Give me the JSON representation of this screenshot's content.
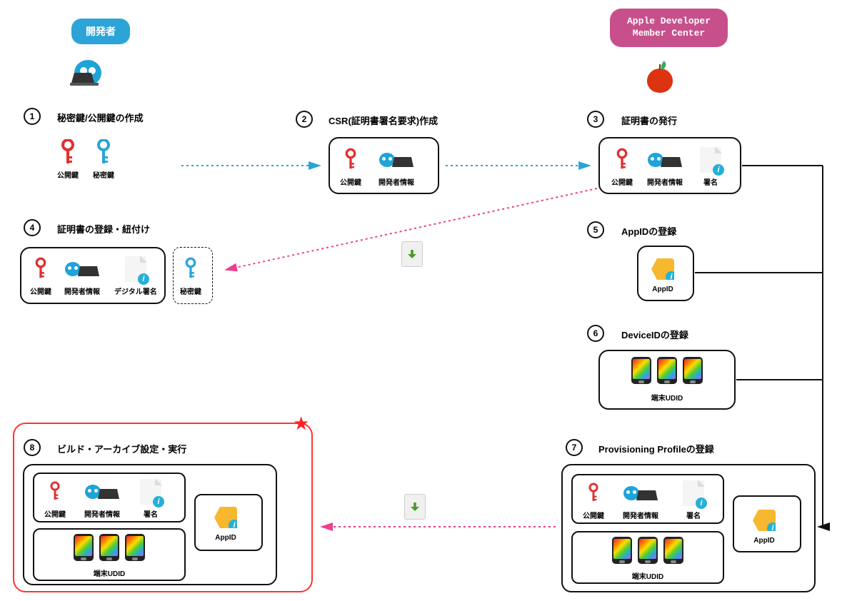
{
  "header": {
    "developer": "開発者",
    "apple_line1": "Apple Developer",
    "apple_line2": "Member Center"
  },
  "steps": {
    "s1": {
      "num": "1",
      "title": "秘密鍵/公開鍵の作成",
      "pubkey": "公開鍵",
      "privkey": "秘密鍵"
    },
    "s2": {
      "num": "2",
      "title": "CSR(証明書署名要求)作成",
      "pubkey": "公開鍵",
      "devinfo": "開発者情報"
    },
    "s3": {
      "num": "3",
      "title": "証明書の発行",
      "pubkey": "公開鍵",
      "devinfo": "開発者情報",
      "sign": "署名"
    },
    "s4": {
      "num": "4",
      "title": "証明書の登録・紐付け",
      "pubkey": "公開鍵",
      "devinfo": "開発者情報",
      "digsign": "デジタル署名",
      "privkey": "秘密鍵"
    },
    "s5": {
      "num": "5",
      "title": "AppIDの登録",
      "appid": "AppID"
    },
    "s6": {
      "num": "6",
      "title": "DeviceIDの登録",
      "udid": "端末UDID"
    },
    "s7": {
      "num": "7",
      "title": "Provisioning Profileの登録",
      "pubkey": "公開鍵",
      "devinfo": "開発者情報",
      "sign": "署名",
      "appid": "AppID",
      "udid": "端末UDID"
    },
    "s8": {
      "num": "8",
      "title": "ビルド・アーカイブ設定・実行",
      "pubkey": "公開鍵",
      "devinfo": "開発者情報",
      "sign": "署名",
      "appid": "AppID",
      "udid": "端末UDID"
    }
  },
  "icons": {
    "star": "★"
  }
}
